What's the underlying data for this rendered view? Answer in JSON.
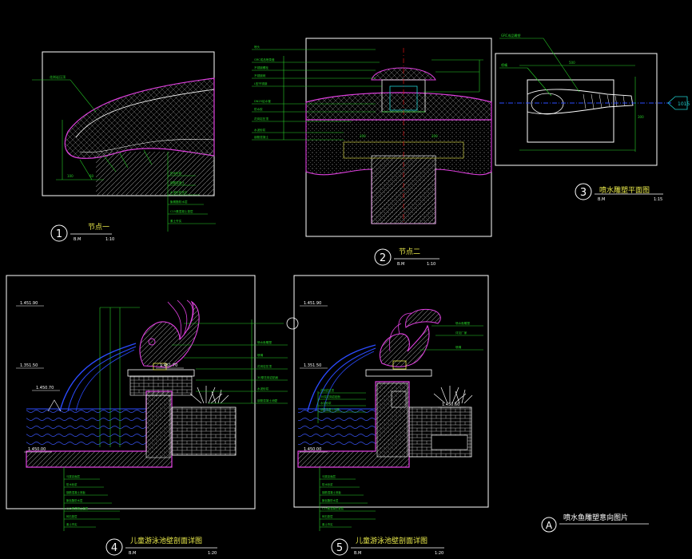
{
  "drawings": [
    {
      "num": "1",
      "title": "节点一",
      "scale_left": "B.M",
      "scale_right": "1:10"
    },
    {
      "num": "2",
      "title": "节点二",
      "scale_left": "B.M",
      "scale_right": "1:10"
    },
    {
      "num": "3",
      "title": "喷水雕塑平面图",
      "scale_left": "B.M",
      "scale_right": "1:15"
    },
    {
      "num": "4",
      "title": "儿童游泳池壁剖面详图",
      "scale_left": "B.M",
      "scale_right": "1:20"
    },
    {
      "num": "5",
      "title": "儿童游泳池壁剖面详图",
      "scale_left": "B.M",
      "scale_right": "1:20"
    },
    {
      "num": "A",
      "title": "喷水鱼雕塑意向图片",
      "scale_left": "",
      "scale_right": ""
    }
  ],
  "levels": {
    "d4_top": "1.451.90",
    "d4_mid": "1.351.50",
    "d4_low": "1.450.70",
    "d4_bottom": "1.450.00",
    "d4_wall": "1.451.70",
    "d5_top": "1.451.90",
    "d5_mid": "1.351.50",
    "d5_low": "1.451.70",
    "d5_bottom": "1.450.00",
    "d5_wall": "1.450.60"
  },
  "ref_tag": "1015",
  "dims": {
    "d1_a": "100",
    "d1_b": "60",
    "d2_a": "200",
    "d2_b": "200",
    "d3_w": "500",
    "d3_h": "300"
  },
  "colors": {
    "bg": "#000000",
    "frame": "#ffffff",
    "green": "#27d127",
    "yellow": "#e8e84a",
    "magenta": "#e040e0",
    "blue": "#2b4bff",
    "red": "#e01010",
    "cyan": "#20d0d0",
    "hatch": "#8a8a8a"
  }
}
